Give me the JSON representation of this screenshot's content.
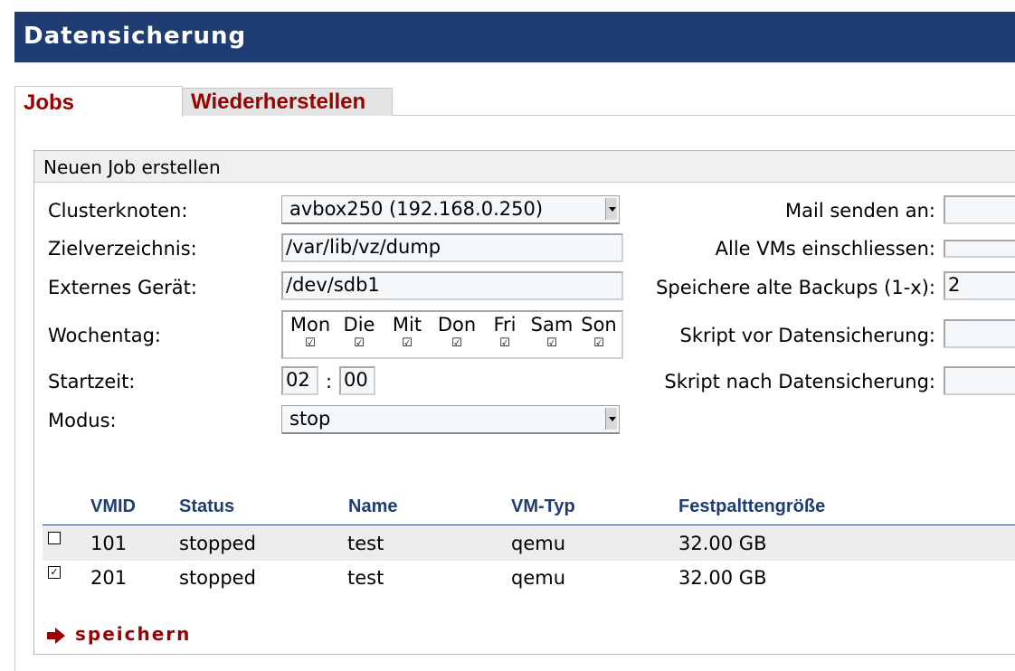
{
  "header": {
    "title": "Datensicherung"
  },
  "tabs": [
    {
      "label": "Jobs"
    },
    {
      "label": "Wiederherstellen"
    }
  ],
  "panel": {
    "title": "Neuen Job erstellen",
    "labels": {
      "node": "Clusterknoten:",
      "target_dir": "Zielverzeichnis:",
      "external": "Externes Gerät:",
      "weekday": "Wochentag:",
      "start": "Startzeit:",
      "mode": "Modus:",
      "mail": "Mail senden an:",
      "all_vms": "Alle VMs einschliessen:",
      "keep_backups": "Speichere alte Backups (1-x):",
      "script_before": "Skript vor Datensicherung:",
      "script_after": "Skript nach Datensicherung:"
    },
    "values": {
      "node": "avbox250 (192.168.0.250)",
      "target_dir": "/var/lib/vz/dump",
      "external": "/dev/sdb1",
      "start_hour": "02",
      "time_sep": ":",
      "start_minute": "00",
      "mode": "stop",
      "mail": "",
      "keep_backups": "2",
      "script_before": "",
      "script_after": ""
    },
    "days": [
      {
        "name": "Mon",
        "checked": true
      },
      {
        "name": "Die",
        "checked": true
      },
      {
        "name": "Mit",
        "checked": true
      },
      {
        "name": "Don",
        "checked": true
      },
      {
        "name": "Fri",
        "checked": true
      },
      {
        "name": "Sam",
        "checked": true
      },
      {
        "name": "Son",
        "checked": true
      }
    ]
  },
  "table": {
    "headers": [
      "VMID",
      "Status",
      "Name",
      "VM-Typ",
      "Festpalttengröße"
    ],
    "rows": [
      {
        "selected": false,
        "vmid": "101",
        "status": "stopped",
        "name": "test",
        "type": "qemu",
        "size": "32.00 GB"
      },
      {
        "selected": true,
        "vmid": "201",
        "status": "stopped",
        "name": "test",
        "type": "qemu",
        "size": "32.00 GB"
      }
    ]
  },
  "save": {
    "label": "speichern"
  },
  "colors": {
    "header_bg": "#1f3d73",
    "accent_red": "#9b0000",
    "table_header": "#1f3d73"
  }
}
